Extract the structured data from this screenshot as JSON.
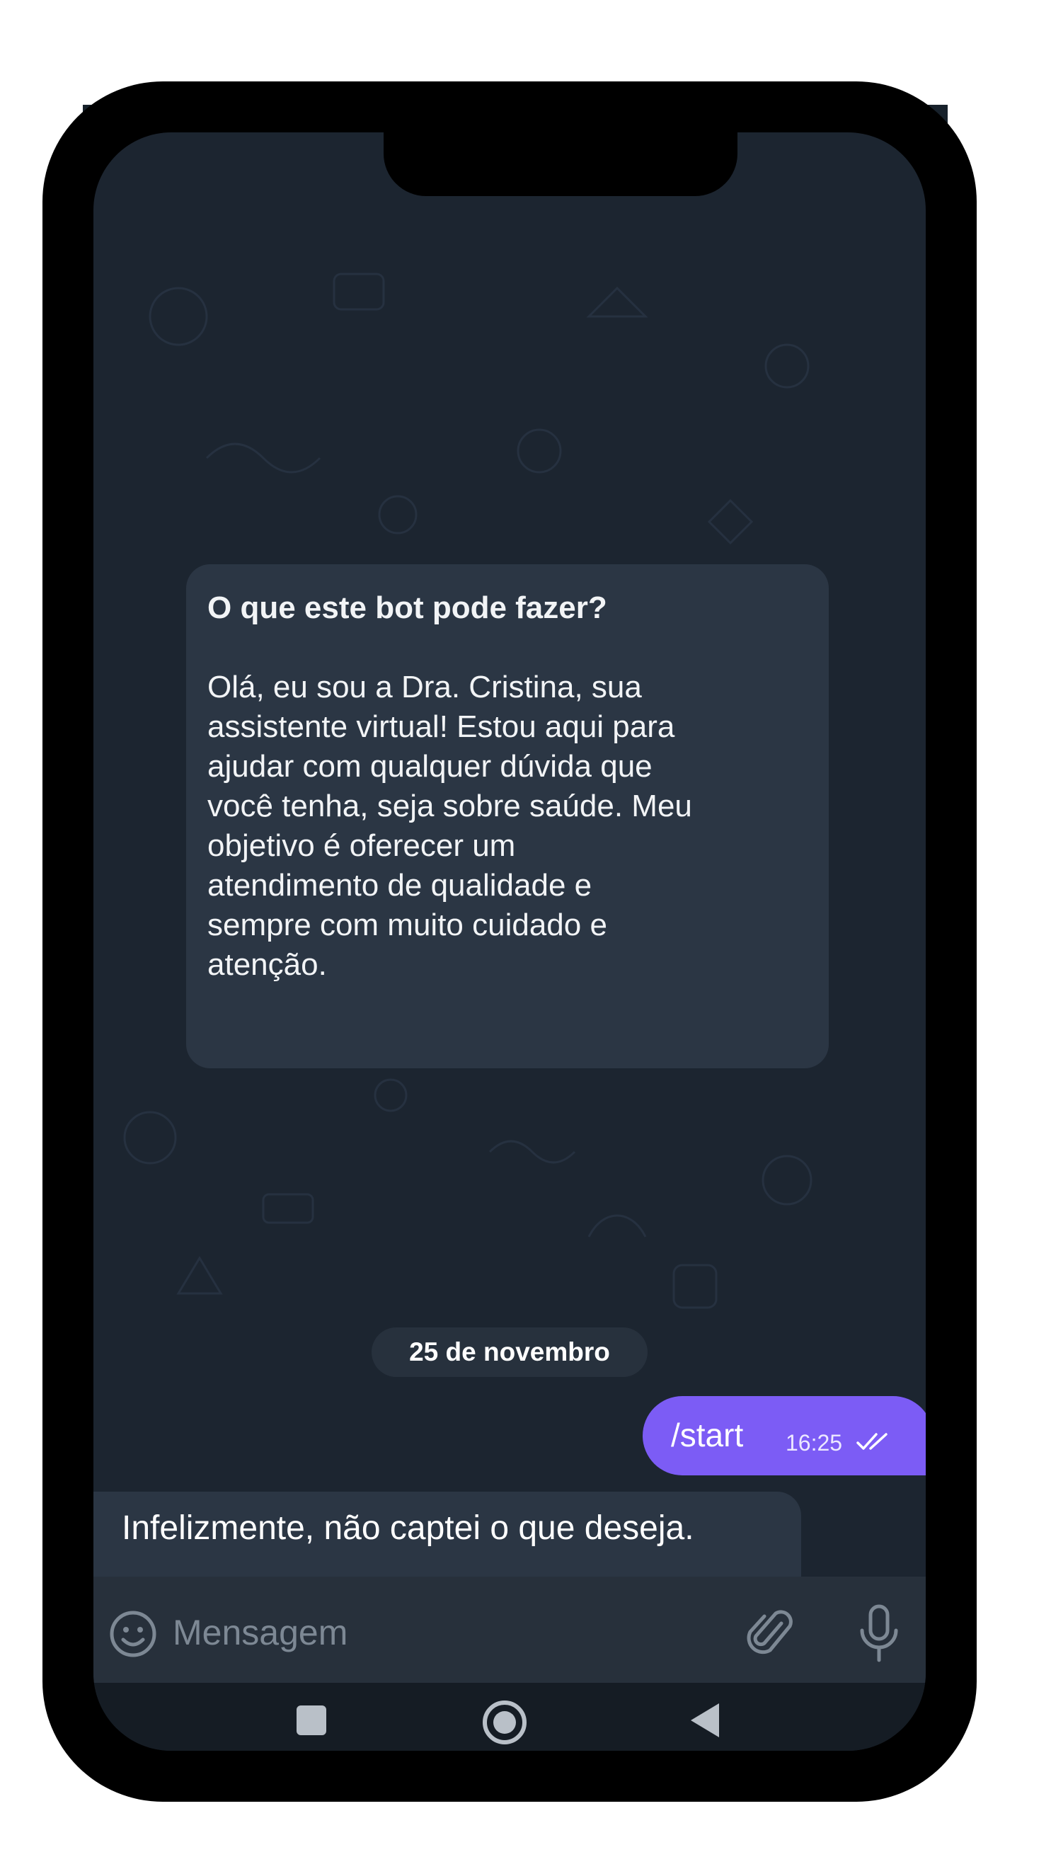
{
  "intro_card": {
    "title": "O que este bot pode fazer?",
    "lines": [
      "Olá, eu sou a Dra. Cristina, sua",
      "assistente virtual! Estou aqui para",
      "ajudar com qualquer dúvida que",
      "você tenha, seja sobre saúde. Meu",
      "objetivo é oferecer um",
      "atendimento de qualidade e",
      "sempre com muito cuidado e",
      "atenção."
    ]
  },
  "date_separator": "25 de novembro",
  "outgoing_message": {
    "text": "/start",
    "time": "16:25",
    "status_icon": "double-check-icon"
  },
  "incoming_message": {
    "text": "Infelizmente, não captei o que deseja."
  },
  "composer": {
    "placeholder": "Mensagem",
    "emoji_icon": "emoji-icon",
    "attach_icon": "paperclip-icon",
    "mic_icon": "microphone-icon"
  },
  "navigation_bar": {
    "icons": [
      "recent-apps-icon",
      "home-icon",
      "back-icon"
    ]
  },
  "colors": {
    "chat_background": "#1c2530",
    "incoming_bubble": "#2b3644",
    "outgoing_bubble": "#7c5cf5",
    "phone_frame": "#000000"
  }
}
